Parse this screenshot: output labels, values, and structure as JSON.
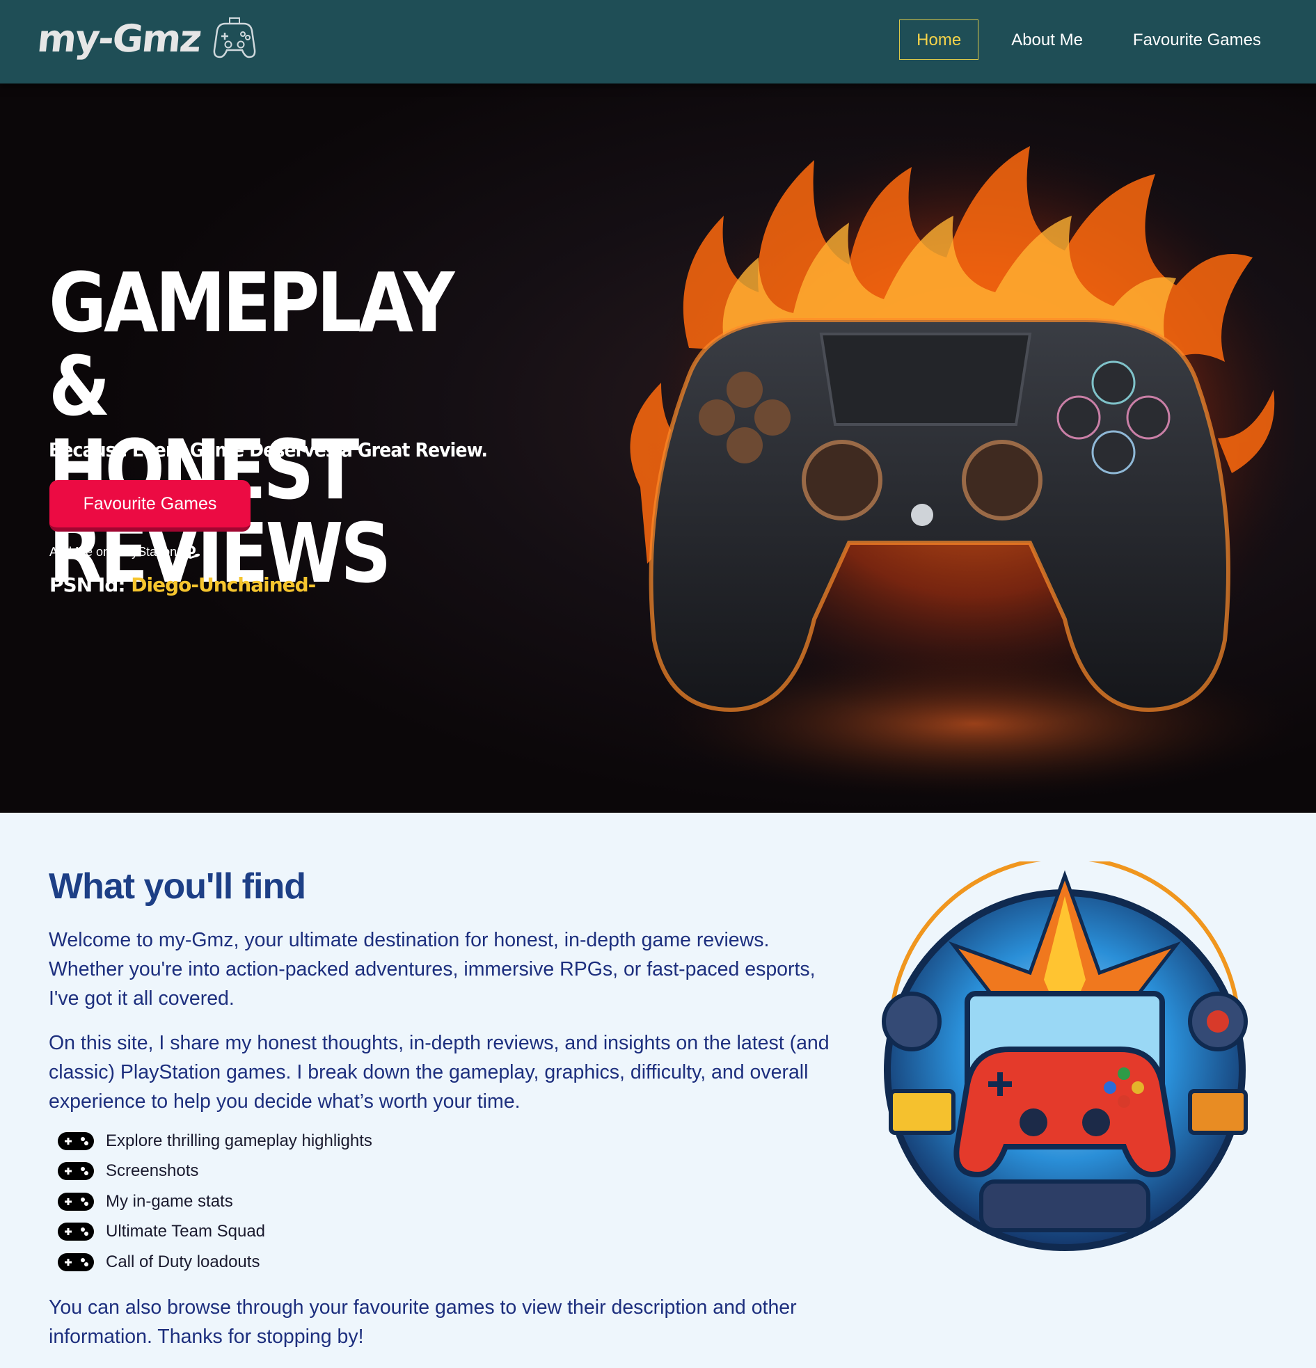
{
  "nav": {
    "logo_text": "my-Gmz",
    "links": [
      {
        "label": "Home",
        "active": true
      },
      {
        "label": "About Me",
        "active": false
      },
      {
        "label": "Favourite Games",
        "active": false
      }
    ]
  },
  "hero": {
    "title_line1": "GAMEPLAY &",
    "title_line2": "HONEST REVIEWS",
    "subtitle": "Because Every Game Deserves a Great Review.",
    "cta_label": "Favourite Games",
    "psn_add_label": "Add Me on PlayStation",
    "psn_id_label": "PSN Id:",
    "psn_id_value": "Diego-Unchained-"
  },
  "about": {
    "title": "What you'll find",
    "paragraph1": "Welcome to my-Gmz, your ultimate destination for honest, in-depth game reviews. Whether you're into action-packed adventures, immersive RPGs, or fast-paced esports, I've got it all covered.",
    "paragraph2": "On this site, I share my honest thoughts, in-depth reviews, and insights on the latest (and classic) PlayStation games. I break down the gameplay, graphics, difficulty, and overall experience to help you decide what’s worth your time.",
    "features": [
      "Explore thrilling gameplay highlights",
      "Screenshots",
      "My in-game stats",
      "Ultimate Team Squad",
      "Call of Duty loadouts"
    ],
    "paragraph3": "You can also browse through your favourite games to view their description and other information. Thanks for stopping by!"
  },
  "icons": {
    "logo": "gamepad-outline-icon",
    "playstation": "playstation-icon",
    "list_bullet": "gamepad-icon"
  },
  "colors": {
    "nav_bg": "#1f4e56",
    "active_link": "#f5d34a",
    "cta": "#ec0b43",
    "psn_id": "#f6c52e",
    "section_title": "#1d3f86",
    "content_bg": "#eef6fc"
  }
}
